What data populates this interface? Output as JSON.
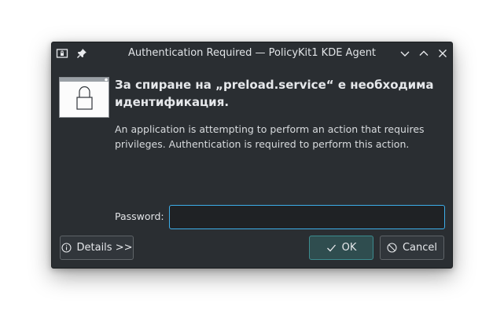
{
  "window": {
    "title": "Authentication Required — PolicyKit1 KDE Agent"
  },
  "dialog": {
    "heading": "За спиране на „preload.service“ е необходима идентификация.",
    "description": "An application is attempting to perform an action that requires privileges. Authentication is required to perform this action.",
    "password_label": "Password:",
    "password_value": ""
  },
  "buttons": {
    "details": "Details >>",
    "ok": "OK",
    "cancel": "Cancel"
  },
  "colors": {
    "accent": "#3daee9",
    "window_bg": "#2a2e32"
  }
}
